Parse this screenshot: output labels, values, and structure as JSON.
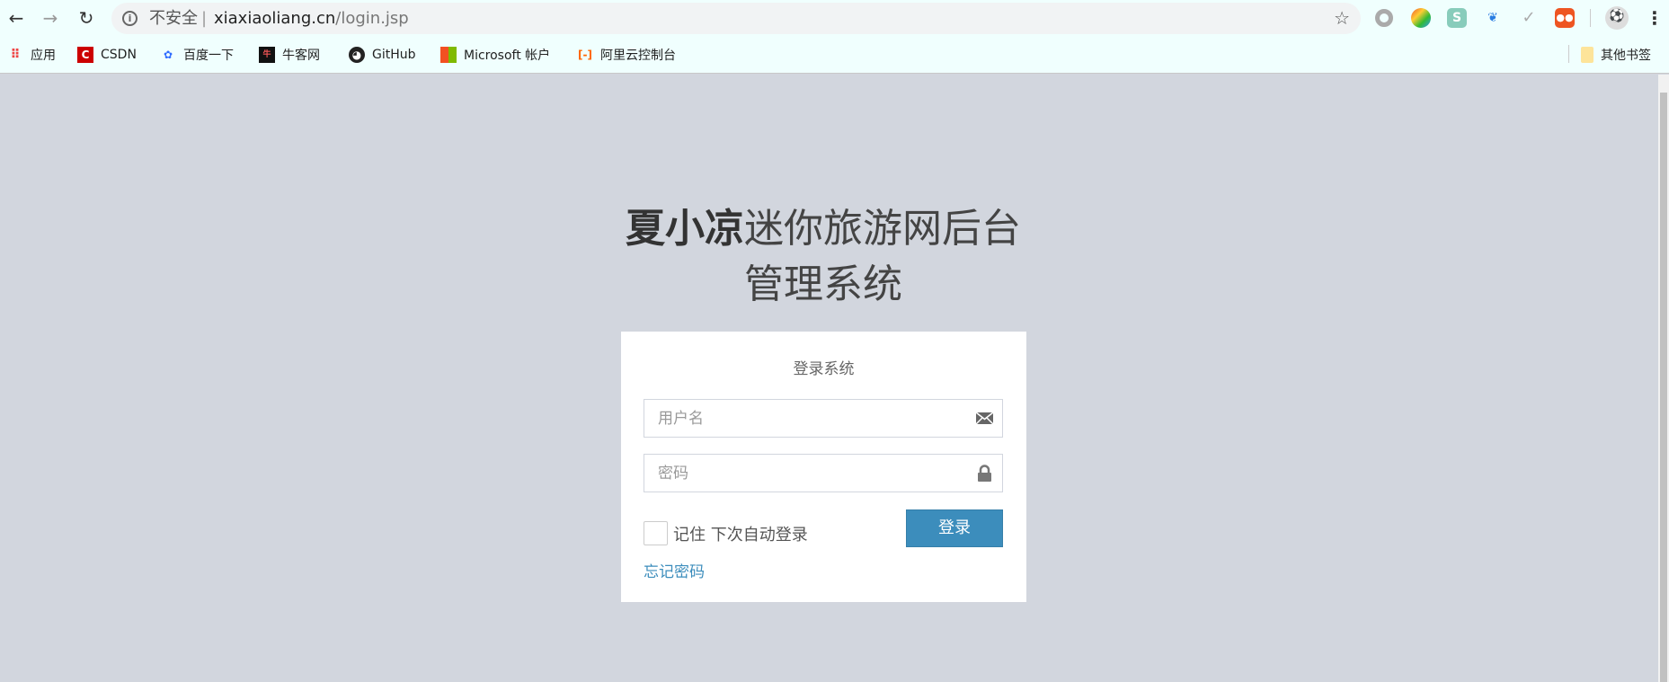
{
  "browser": {
    "insecure_label": "不安全",
    "url_host": "xiaxiaoliang.cn",
    "url_path": "/login.jsp",
    "bookmarks": [
      {
        "label": "应用",
        "icon": "apps-grid-icon"
      },
      {
        "label": "CSDN",
        "icon": "csdn-icon"
      },
      {
        "label": "百度一下",
        "icon": "baidu-paw-icon"
      },
      {
        "label": "牛客网",
        "icon": "nowcoder-icon"
      },
      {
        "label": "GitHub",
        "icon": "github-icon"
      },
      {
        "label": "Microsoft 帐户",
        "icon": "microsoft-icon"
      },
      {
        "label": "阿里云控制台",
        "icon": "aliyun-icon"
      }
    ],
    "other_bookmarks": "其他书签"
  },
  "page": {
    "title_bold": "夏小凉",
    "title_rest": "迷你旅游网后台",
    "title_line2": "管理系统"
  },
  "login": {
    "heading": "登录系统",
    "username_placeholder": "用户名",
    "password_placeholder": "密码",
    "remember_label": "记住 下次自动登录",
    "submit_label": "登录",
    "forgot_label": "忘记密码"
  },
  "colors": {
    "accent": "#3c8dbc",
    "background": "#d2d6de"
  }
}
